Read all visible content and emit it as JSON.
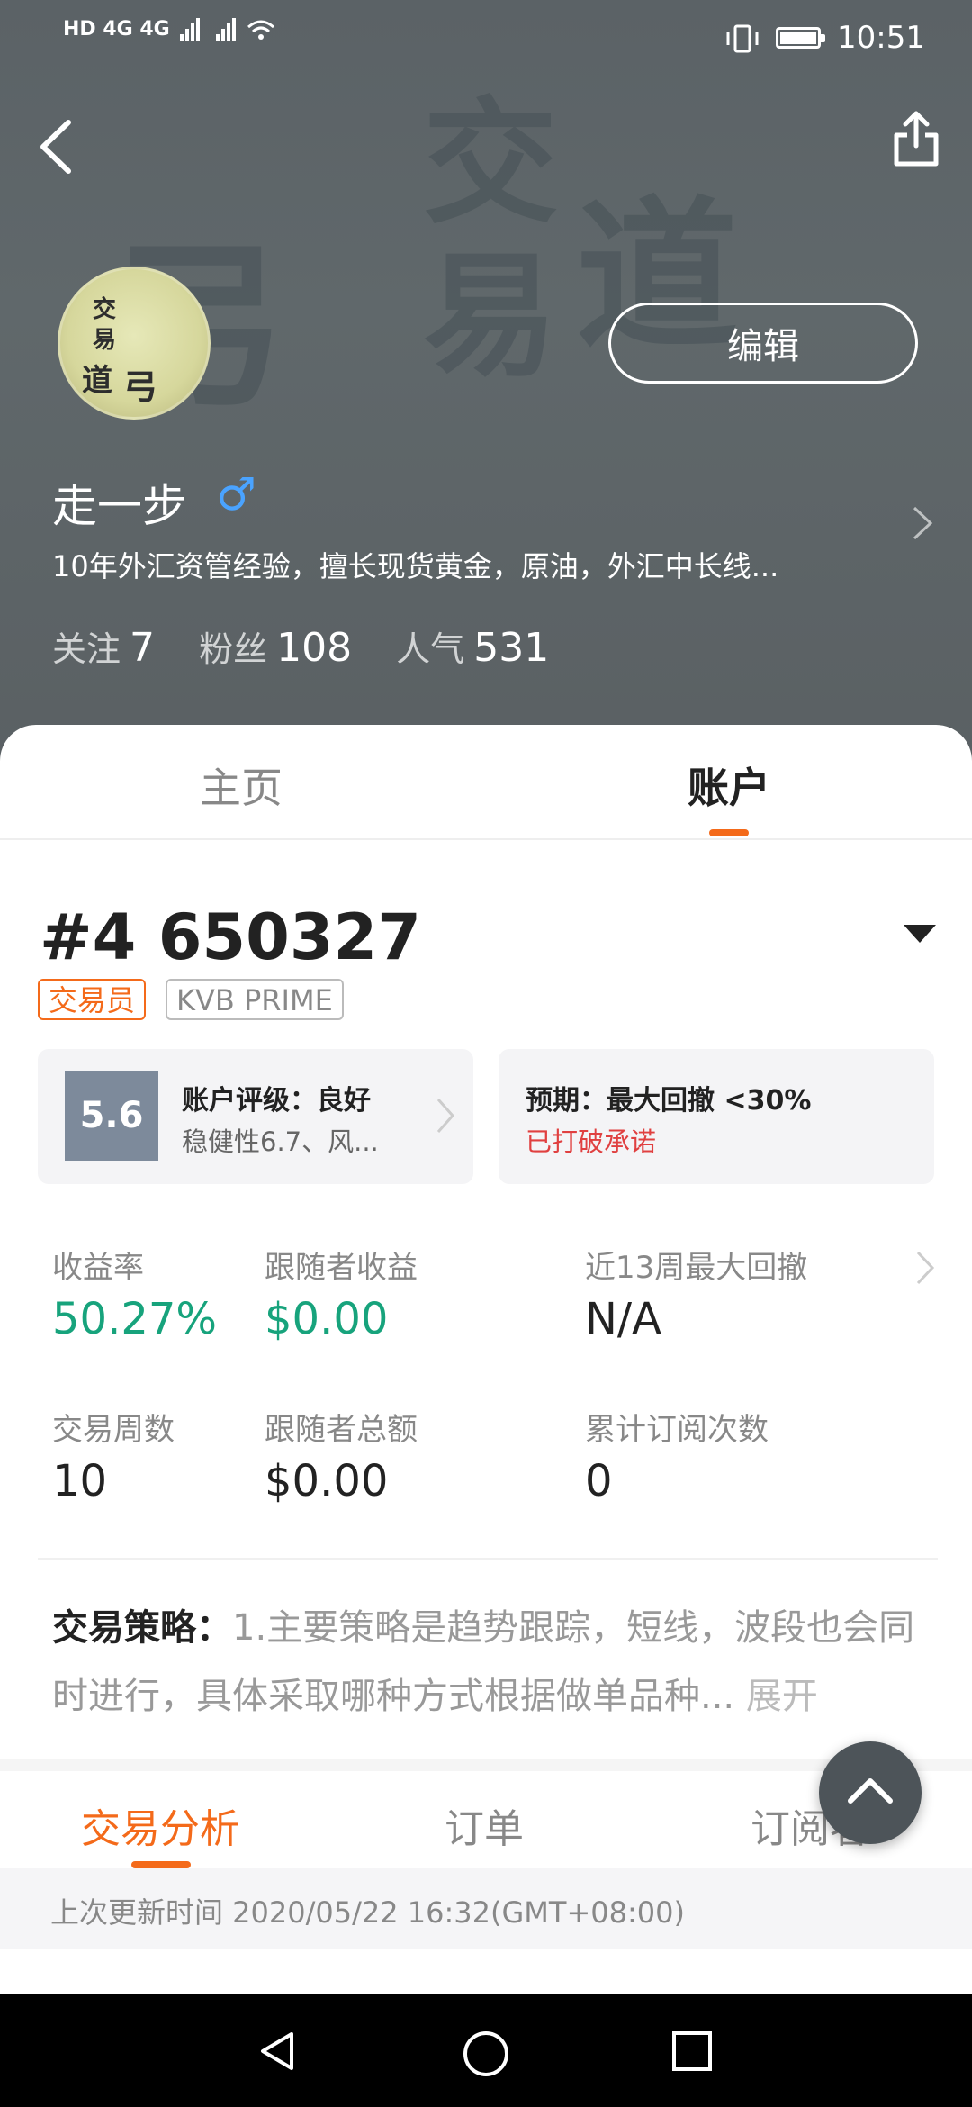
{
  "status_bar": {
    "network": "HD 4G 4G",
    "time": "10:51"
  },
  "header": {
    "edit_label": "编辑",
    "username": "走一步",
    "gender_symbol": "♂",
    "bio": "10年外汇资管经验，擅长现货黄金，原油，外汇中长线...",
    "avatar_text": [
      "交",
      "易",
      "道",
      "弓"
    ],
    "stats": [
      {
        "label": "关注",
        "value": "7"
      },
      {
        "label": "粉丝",
        "value": "108"
      },
      {
        "label": "人气",
        "value": "531"
      }
    ]
  },
  "tabs": {
    "home": "主页",
    "account": "账户"
  },
  "account": {
    "number": "#4 650327",
    "badge_trader": "交易员",
    "badge_broker": "KVB PRIME",
    "rating_score": "5.6",
    "rating_title": "账户评级：良好",
    "rating_sub": "稳健性6.7、风...",
    "expect_title": "预期：最大回撤 <30%",
    "expect_status": "已打破承诺"
  },
  "metrics": [
    {
      "label": "收益率",
      "value": "50.27%"
    },
    {
      "label": "跟随者收益",
      "value": "$0.00"
    },
    {
      "label": "近13周最大回撤",
      "value": "N/A"
    },
    {
      "label": "交易周数",
      "value": "10"
    },
    {
      "label": "跟随者总额",
      "value": "$0.00"
    },
    {
      "label": "累计订阅次数",
      "value": "0"
    }
  ],
  "strategy": {
    "label": "交易策略：",
    "text": "1.主要策略是趋势跟踪，短线，波段也会同时进行，具体采取哪种方式根据做单品种...",
    "more": "展开"
  },
  "subtabs": {
    "analysis": "交易分析",
    "orders": "订单",
    "subscribers": "订阅者"
  },
  "updated": "上次更新时间 2020/05/22 16:32(GMT+08:00)",
  "colors": {
    "accent": "#f46a1a",
    "positive": "#17a37c",
    "warning": "#e04040"
  }
}
